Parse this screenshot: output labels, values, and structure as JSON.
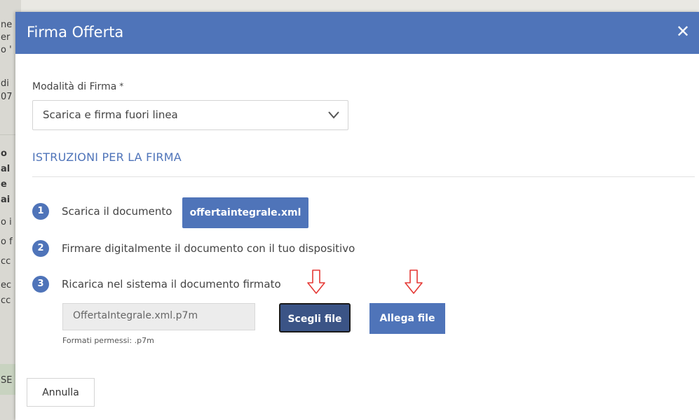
{
  "background": {
    "fragments": [
      {
        "text": "ne"
      },
      {
        "text": "er"
      },
      {
        "text": "o '"
      },
      {
        "text": "di"
      },
      {
        "text": "07"
      },
      {
        "text": "o"
      },
      {
        "text": "al"
      },
      {
        "text": "e"
      },
      {
        "text": "ai"
      },
      {
        "text": "o i"
      },
      {
        "text": "o f"
      },
      {
        "text": "cc"
      },
      {
        "text": "ec"
      },
      {
        "text": "cc"
      },
      {
        "text": "SE"
      }
    ]
  },
  "modal": {
    "title": "Firma Offerta",
    "close_icon": "close-icon",
    "signature_mode": {
      "label": "Modalità di Firma",
      "required_mark": "*",
      "value": "Scarica e firma fuori linea"
    },
    "instructions_title": "ISTRUZIONI PER LA FIRMA",
    "steps": [
      {
        "number": "1",
        "text": "Scarica il documento",
        "button": "offertaintegrale.xml"
      },
      {
        "number": "2",
        "text": "Firmare digitalmente il documento con il tuo dispositivo"
      },
      {
        "number": "3",
        "text": "Ricarica nel sistema il documento firmato"
      }
    ],
    "upload": {
      "file_value": "OffertaIntegrale.xml.p7m",
      "hint": "Formati permessi: .p7m",
      "choose_label": "Scegli file",
      "attach_label": "Allega file"
    },
    "cancel_label": "Annulla"
  },
  "colors": {
    "header": "#4f74b9",
    "accent": "#4f74b9",
    "annotation_arrow": "#e53935"
  }
}
